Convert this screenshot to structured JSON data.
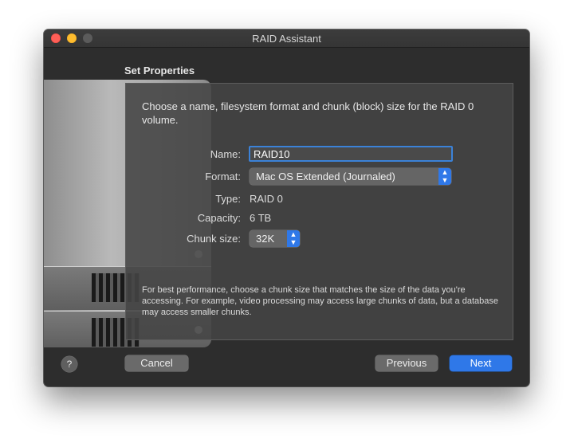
{
  "window": {
    "title": "RAID Assistant"
  },
  "heading": "Set Properties",
  "intro": "Choose a name, filesystem format and chunk (block) size for the RAID 0 volume.",
  "fields": {
    "name_label": "Name:",
    "name_value": "RAID10",
    "format_label": "Format:",
    "format_value": "Mac OS Extended (Journaled)",
    "type_label": "Type:",
    "type_value": "RAID 0",
    "capacity_label": "Capacity:",
    "capacity_value": "6 TB",
    "chunk_label": "Chunk size:",
    "chunk_value": "32K"
  },
  "note": "For best performance, choose a chunk size that matches the size of the data you're accessing. For example, video processing may access large chunks of data, but a database may access smaller chunks.",
  "buttons": {
    "help": "?",
    "cancel": "Cancel",
    "previous": "Previous",
    "next": "Next"
  },
  "colors": {
    "accent": "#2f78e8",
    "close": "#fe5f57",
    "minimize": "#febc2e"
  },
  "icons": {
    "stepper": "up-down-chevron-icon"
  }
}
